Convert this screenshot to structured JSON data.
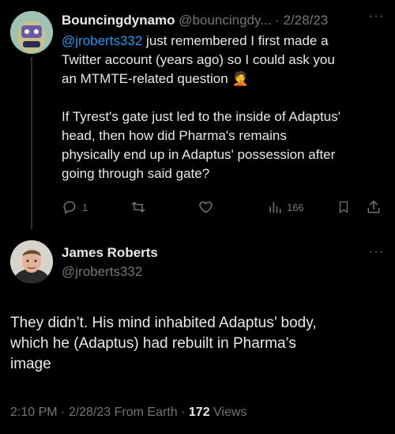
{
  "first_tweet": {
    "author_name": "Bouncingdynamo",
    "author_handle": "@bouncingdy...",
    "date_sep": "·",
    "date": "2/28/23",
    "more": "···",
    "mention": "@jroberts332",
    "text_line1_rest": " just remembered I first made a",
    "text_line2": "Twitter account (years ago) so I could ask you",
    "text_line3": "an MTMTE-related question",
    "emoji": "🤦",
    "para2_line1": "If Tyrest's gate just led to the inside of Adaptus'",
    "para2_line2": "head, then how did Pharma's remains",
    "para2_line3": "physically end up in Adaptus' possession after",
    "para2_line4": "going through said gate?",
    "reply_count": "1",
    "view_count": "166",
    "icons": [
      "reply-icon",
      "retweet-icon",
      "like-icon",
      "views-icon",
      "bookmark-icon",
      "share-icon"
    ]
  },
  "reply_tweet": {
    "author_name": "James Roberts",
    "author_handle": "@jroberts332",
    "more": "···",
    "text_line1": "They didn’t. His mind inhabited Adaptus’ body,",
    "text_line2": "which he (Adaptus) had rebuilt in Pharma’s",
    "text_line3": "image",
    "meta_time": "2:10 PM",
    "meta_sep1": " · ",
    "meta_date": "2/28/23",
    "meta_source": " From Earth",
    "meta_sep2": " · ",
    "views_count": "172",
    "views_label": " Views"
  },
  "colors": {
    "background": "#000000",
    "text": "#e7e9ea",
    "muted": "#71767b",
    "link": "#1d9bf0",
    "divider": "#2f3336"
  }
}
